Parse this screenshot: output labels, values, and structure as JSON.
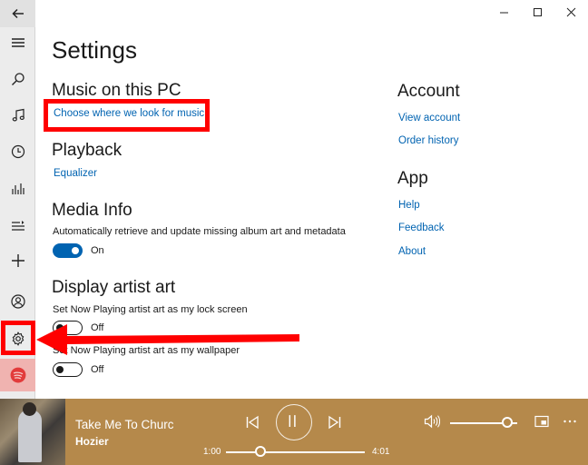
{
  "window": {
    "controls": [
      "minimize",
      "maximize",
      "close"
    ]
  },
  "nav": {
    "items": [
      {
        "icon": "back-arrow-icon"
      },
      {
        "icon": "hamburger-menu-icon"
      },
      {
        "icon": "search-icon"
      },
      {
        "icon": "music-note-icon"
      },
      {
        "icon": "clock-icon"
      },
      {
        "icon": "chart-bars-icon"
      },
      {
        "icon": "playlist-icon"
      },
      {
        "icon": "plus-icon"
      },
      {
        "icon": "person-icon"
      },
      {
        "icon": "gear-icon"
      },
      {
        "icon": "spotify-icon"
      }
    ]
  },
  "settings": {
    "title": "Settings",
    "music_on_pc": {
      "heading": "Music on this PC",
      "link": "Choose where we look for music"
    },
    "playback": {
      "heading": "Playback",
      "link": "Equalizer"
    },
    "media_info": {
      "heading": "Media Info",
      "description": "Automatically retrieve and update missing album art and metadata",
      "toggle_state": "On"
    },
    "artist_art": {
      "heading": "Display artist art",
      "lock_screen_label": "Set Now Playing artist art as my lock screen",
      "lock_screen_state": "Off",
      "wallpaper_label": "Set Now Playing artist art as my wallpaper",
      "wallpaper_state": "Off"
    },
    "account": {
      "heading": "Account",
      "links": [
        "View account",
        "Order history"
      ]
    },
    "app": {
      "heading": "App",
      "links": [
        "Help",
        "Feedback",
        "About"
      ]
    }
  },
  "player": {
    "title": "Take Me To Church",
    "artist": "Hozier",
    "elapsed": "1:00",
    "duration": "4:01",
    "progress_fraction": 0.25,
    "volume_fraction": 0.85
  },
  "colors": {
    "accent": "#0063b1",
    "player_bg": "#b5894b",
    "annotation": "#ff0000"
  }
}
